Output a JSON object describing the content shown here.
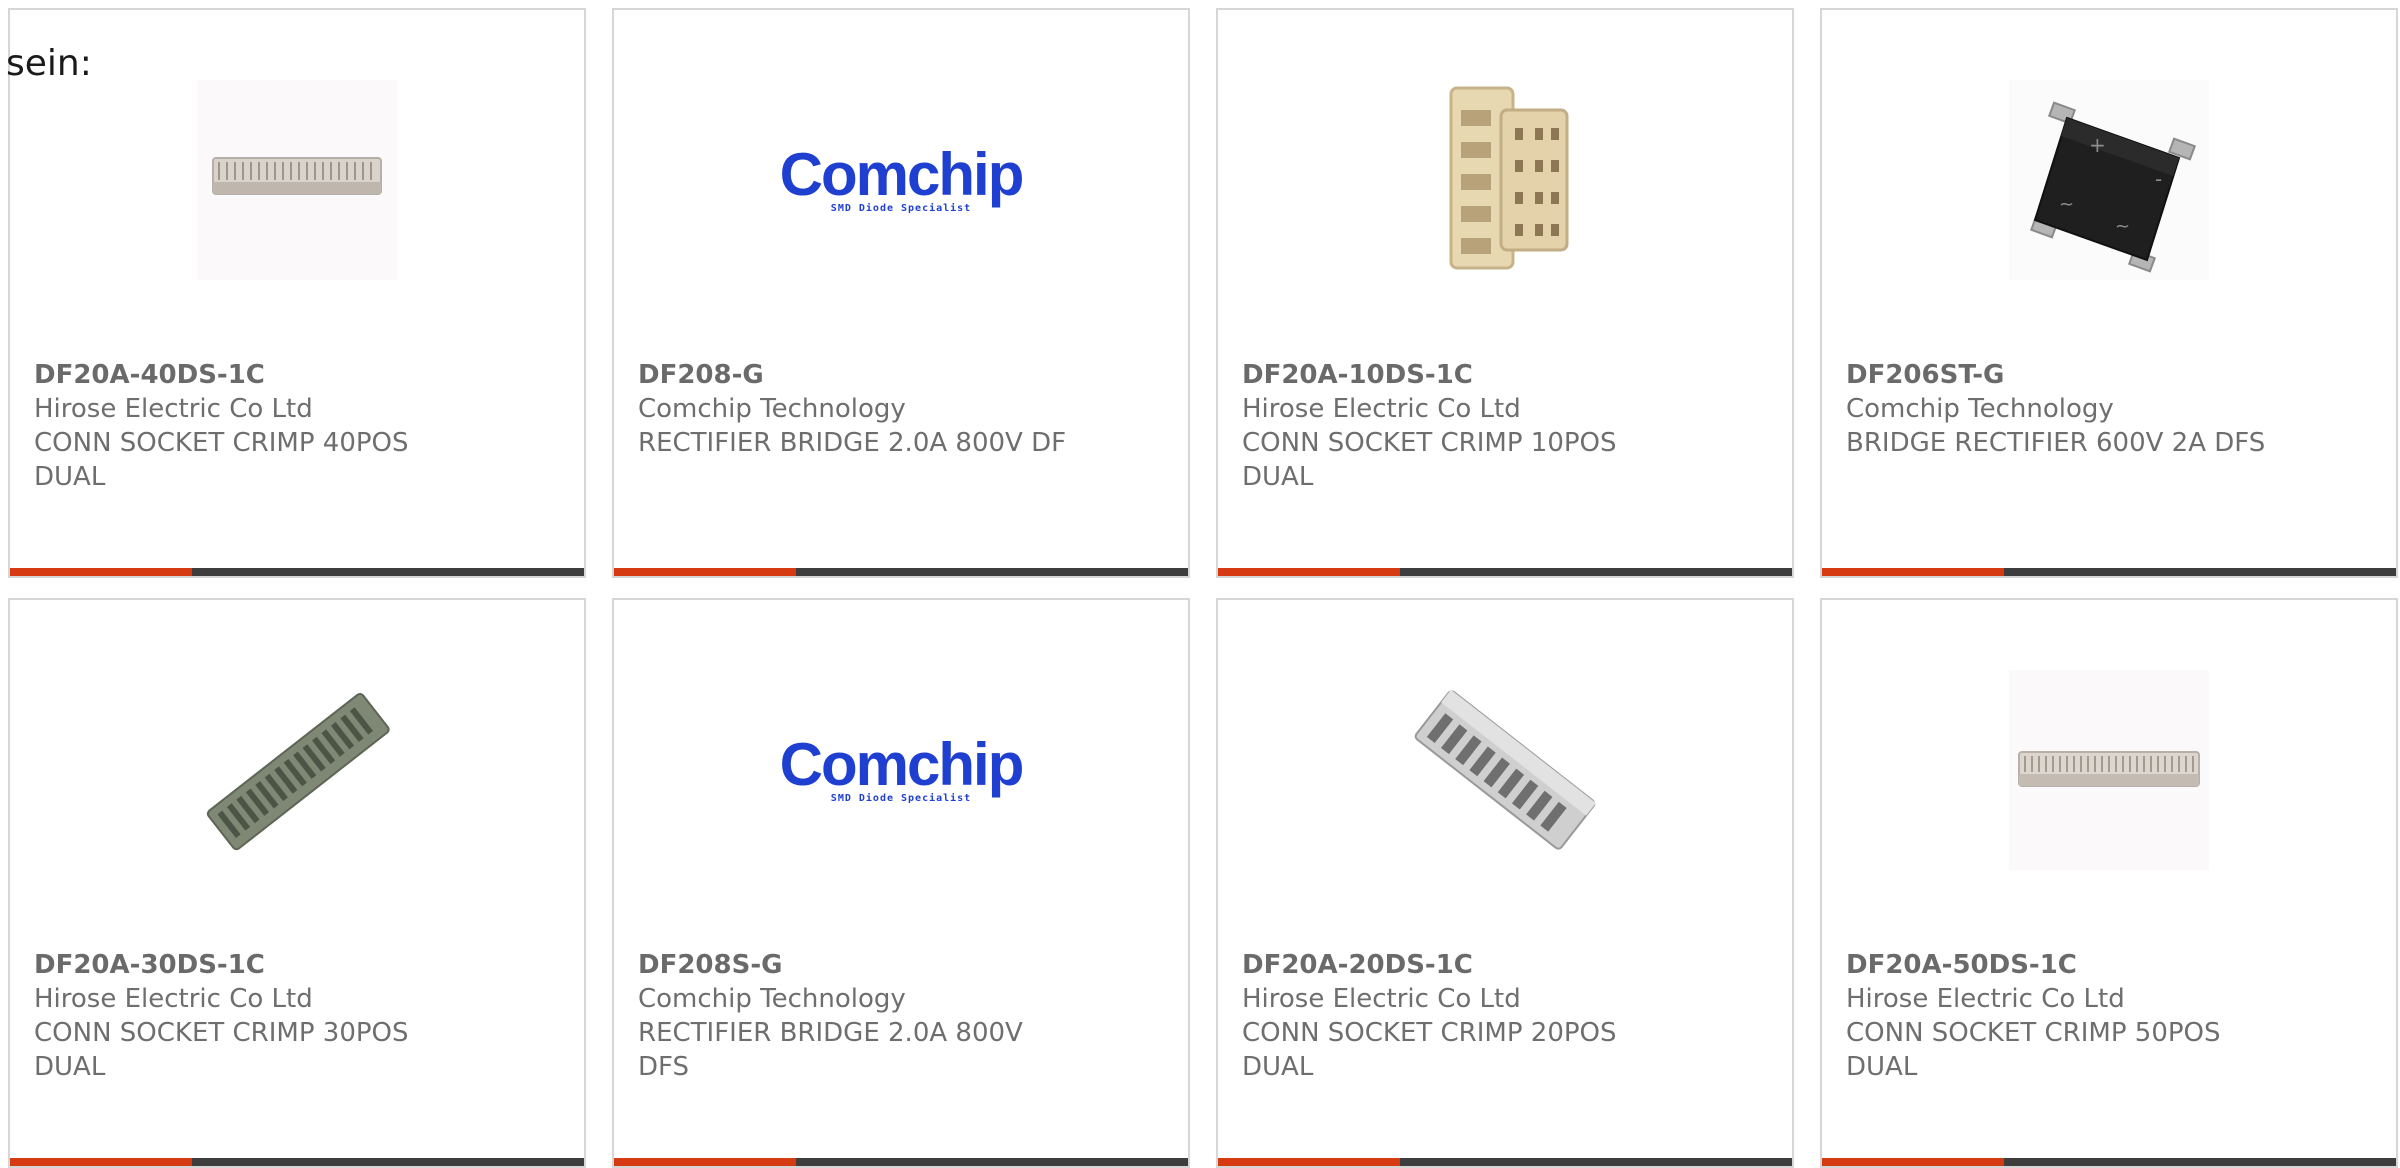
{
  "intro_text": "sein:",
  "accent_color": "#d63a12",
  "products": [
    {
      "part_number": "DF20A-40DS-1C",
      "manufacturer": "Hirose Electric Co Ltd",
      "description": "CONN SOCKET CRIMP 40POS DUAL",
      "image": "connector-40pos-icon"
    },
    {
      "part_number": "DF208-G",
      "manufacturer": "Comchip Technology",
      "description": "RECTIFIER BRIDGE 2.0A 800V DF",
      "image": "comchip-logo",
      "logo_word": "Comchip",
      "logo_tagline": "SMD Diode Specialist"
    },
    {
      "part_number": "DF20A-10DS-1C",
      "manufacturer": "Hirose Electric Co Ltd",
      "description": "CONN SOCKET CRIMP 10POS DUAL",
      "image": "connector-10pos-icon"
    },
    {
      "part_number": "DF206ST-G",
      "manufacturer": "Comchip Technology",
      "description": "BRIDGE RECTIFIER 600V 2A DFS",
      "image": "bridge-rectifier-icon"
    },
    {
      "part_number": "DF20A-30DS-1C",
      "manufacturer": "Hirose Electric Co Ltd",
      "description": "CONN SOCKET CRIMP 30POS DUAL",
      "image": "connector-30pos-icon"
    },
    {
      "part_number": "DF208S-G",
      "manufacturer": "Comchip Technology",
      "description": "RECTIFIER BRIDGE 2.0A 800V DFS",
      "image": "comchip-logo",
      "logo_word": "Comchip",
      "logo_tagline": "SMD Diode Specialist"
    },
    {
      "part_number": "DF20A-20DS-1C",
      "manufacturer": "Hirose Electric Co Ltd",
      "description": "CONN SOCKET CRIMP 20POS DUAL",
      "image": "connector-20pos-icon"
    },
    {
      "part_number": "DF20A-50DS-1C",
      "manufacturer": "Hirose Electric Co Ltd",
      "description": "CONN SOCKET CRIMP 50POS DUAL",
      "image": "connector-50pos-icon"
    }
  ]
}
